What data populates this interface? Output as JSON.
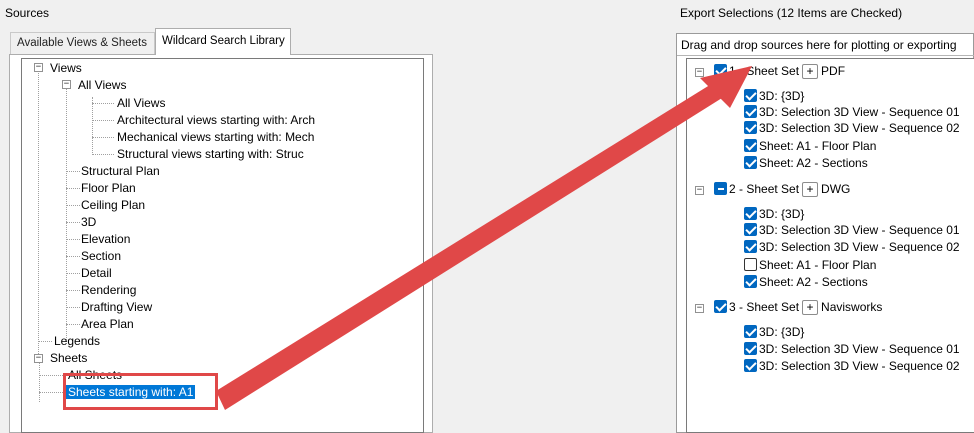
{
  "sources": {
    "title": "Sources",
    "tabs": [
      {
        "label": "Available Views & Sheets"
      },
      {
        "label": "Wildcard Search Library"
      }
    ],
    "tree": {
      "views": "Views",
      "all_views_group": "All Views",
      "all_views_children": [
        "All Views",
        "Architectural views starting with: Arch",
        "Mechanical views starting with: Mech",
        "Structural views starting with: Struc"
      ],
      "view_types": [
        "Structural Plan",
        "Floor Plan",
        "Ceiling Plan",
        "3D",
        "Elevation",
        "Section",
        "Detail",
        "Rendering",
        "Drafting View",
        "Area Plan"
      ],
      "legends": "Legends",
      "sheets": "Sheets",
      "sheets_children": [
        "All Sheets",
        "Sheets starting with: A1"
      ],
      "expander_minus": "⊟"
    }
  },
  "export": {
    "title": "Export Selections (12 Items are Checked)",
    "hint": "Drag and drop sources here for plotting or exporting",
    "plus_label": "+",
    "minus_label": "−",
    "sets": [
      {
        "label": "1 - Sheet Set",
        "format": "PDF",
        "state": "checked",
        "items": [
          {
            "label": "3D: {3D}",
            "checked": true
          },
          {
            "label": "3D: Selection 3D View - Sequence 01",
            "checked": true
          },
          {
            "label": "3D: Selection 3D View - Sequence 02",
            "checked": true
          },
          {
            "label": "Sheet: A1 - Floor Plan",
            "checked": true
          },
          {
            "label": "Sheet: A2 - Sections",
            "checked": true
          }
        ]
      },
      {
        "label": "2 - Sheet Set",
        "format": "DWG",
        "state": "partial",
        "items": [
          {
            "label": "3D: {3D}",
            "checked": true
          },
          {
            "label": "3D: Selection 3D View - Sequence 01",
            "checked": true
          },
          {
            "label": "3D: Selection 3D View - Sequence 02",
            "checked": true
          },
          {
            "label": "Sheet: A1 - Floor Plan",
            "checked": false
          },
          {
            "label": "Sheet: A2 - Sections",
            "checked": true
          }
        ]
      },
      {
        "label": "3 - Sheet Set",
        "format": "Navisworks",
        "state": "checked",
        "items": [
          {
            "label": "3D: {3D}",
            "checked": true
          },
          {
            "label": "3D: Selection 3D View - Sequence 01",
            "checked": true
          },
          {
            "label": "3D: Selection 3D View - Sequence 02",
            "checked": true
          }
        ]
      }
    ]
  },
  "colors": {
    "accent": "#0067c0",
    "selection": "#0078d7",
    "annotation": "#e04848"
  }
}
